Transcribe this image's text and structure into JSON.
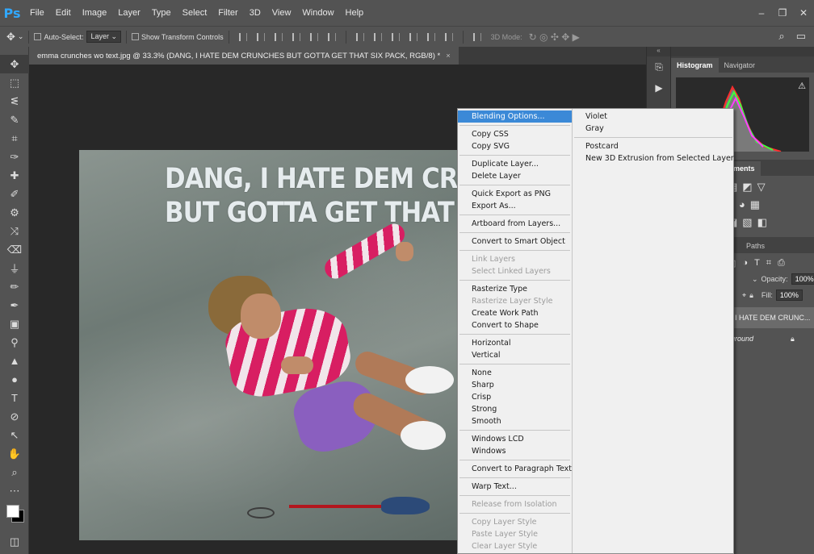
{
  "app": {
    "logo": "Ps"
  },
  "menubar": {
    "items": [
      "File",
      "Edit",
      "Image",
      "Layer",
      "Type",
      "Select",
      "Filter",
      "3D",
      "View",
      "Window",
      "Help"
    ]
  },
  "window_controls": {
    "minimize": "–",
    "restore": "❐",
    "close": "✕"
  },
  "options_bar": {
    "auto_select_label": "Auto-Select:",
    "auto_select_value": "Layer",
    "transform_controls_label": "Show Transform Controls",
    "mode_3d_label": "3D Mode:"
  },
  "document": {
    "tab_title": "emma crunches wo text.jpg @ 33.3% (DANG, I HATE DEM CRUNCHES BUT GOTTA GET THAT SIX PACK, RGB/8) *",
    "tab_close": "×",
    "image_text_line1": "DANG, I HATE DEM CRUNC",
    "image_text_line2": "BUT GOTTA GET THAT SIX"
  },
  "panels": {
    "histogram_tab": "Histogram",
    "navigator_tab": "Navigator",
    "adjustments_tab": "ments",
    "paths_tab": "Paths",
    "opacity_label": "Opacity:",
    "opacity_value": "100%",
    "fill_label": "Fill:",
    "fill_value": "100%",
    "layer_text_name": ", I HATE DEM CRUNC...",
    "layer_background_name": "ground"
  },
  "context_menu": {
    "col1": [
      {
        "label": "Blending Options...",
        "state": "highlighted"
      },
      {
        "sep": true
      },
      {
        "label": "Copy CSS"
      },
      {
        "label": "Copy SVG"
      },
      {
        "sep": true
      },
      {
        "label": "Duplicate Layer..."
      },
      {
        "label": "Delete Layer"
      },
      {
        "sep": true
      },
      {
        "label": "Quick Export as PNG"
      },
      {
        "label": "Export As..."
      },
      {
        "sep": true
      },
      {
        "label": "Artboard from Layers..."
      },
      {
        "sep": true
      },
      {
        "label": "Convert to Smart Object"
      },
      {
        "sep": true
      },
      {
        "label": "Link Layers",
        "state": "disabled"
      },
      {
        "label": "Select Linked Layers",
        "state": "disabled"
      },
      {
        "sep": true
      },
      {
        "label": "Rasterize Type"
      },
      {
        "label": "Rasterize Layer Style",
        "state": "disabled"
      },
      {
        "label": "Create Work Path"
      },
      {
        "label": "Convert to Shape"
      },
      {
        "sep": true
      },
      {
        "label": "Horizontal"
      },
      {
        "label": "Vertical"
      },
      {
        "sep": true
      },
      {
        "label": "None"
      },
      {
        "label": "Sharp"
      },
      {
        "label": "Crisp"
      },
      {
        "label": "Strong"
      },
      {
        "label": "Smooth"
      },
      {
        "sep": true
      },
      {
        "label": "Windows LCD"
      },
      {
        "label": "Windows"
      },
      {
        "sep": true
      },
      {
        "label": "Convert to Paragraph Text"
      },
      {
        "sep": true
      },
      {
        "label": "Warp Text..."
      },
      {
        "sep": true
      },
      {
        "label": "Release from Isolation",
        "state": "disabled"
      },
      {
        "sep": true
      },
      {
        "label": "Copy Layer Style",
        "state": "disabled"
      },
      {
        "label": "Paste Layer Style",
        "state": "disabled"
      },
      {
        "label": "Clear Layer Style",
        "state": "disabled"
      }
    ],
    "col2": [
      {
        "label": "Violet"
      },
      {
        "label": "Gray"
      },
      {
        "sep": true
      },
      {
        "label": "Postcard"
      },
      {
        "label": "New 3D Extrusion from Selected Layer"
      }
    ]
  }
}
